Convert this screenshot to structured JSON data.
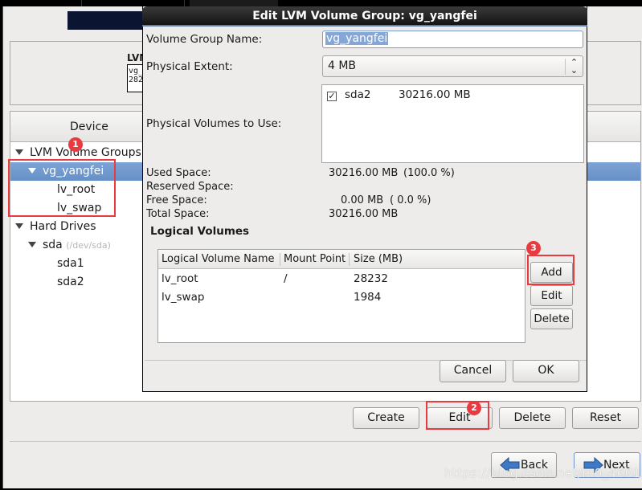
{
  "main_window": {
    "summary": {
      "title": "LVM",
      "mini_line1": "vg_",
      "mini_line2": "282"
    },
    "tree": {
      "column_header": "Device",
      "rows": [
        {
          "label": "LVM Volume Groups",
          "expandable": true,
          "level": 0
        },
        {
          "label": "vg_yangfei",
          "expandable": true,
          "level": 1,
          "selected": true
        },
        {
          "label": "lv_root",
          "level": 2
        },
        {
          "label": "lv_swap",
          "level": 2
        },
        {
          "label": "Hard Drives",
          "expandable": true,
          "level": 0
        },
        {
          "label": "sda",
          "sublabel": "(/dev/sda)",
          "expandable": true,
          "level": 1
        },
        {
          "label": "sda1",
          "level": 2
        },
        {
          "label": "sda2",
          "level": 2
        }
      ]
    },
    "actions": {
      "create": "Create",
      "edit": "Edit",
      "delete": "Delete",
      "reset": "Reset"
    },
    "nav": {
      "back": "Back",
      "next": "Next"
    }
  },
  "dialog": {
    "title": "Edit LVM Volume Group: vg_yangfei",
    "vg_name_label": "Volume Group Name:",
    "vg_name_value": "vg_yangfei",
    "pe_label": "Physical Extent:",
    "pe_value": "4 MB",
    "pv_label": "Physical Volumes to Use:",
    "physical_volumes": [
      {
        "checked": true,
        "name": "sda2",
        "size": "30216.00 MB"
      }
    ],
    "stats": {
      "used_label": "Used Space:",
      "used_value": "30216.00 MB",
      "used_pct": "(100.0 %)",
      "reserved_label": "Reserved Space:",
      "free_label": "Free Space:",
      "free_value": "0.00 MB",
      "free_pct": "( 0.0 %)",
      "total_label": "Total Space:",
      "total_value": "30216.00 MB"
    },
    "lv_section_title": "Logical Volumes",
    "lv_columns": [
      "Logical Volume Name",
      "Mount Point",
      "Size (MB)"
    ],
    "logical_volumes": [
      {
        "name": "lv_root",
        "mount": "/",
        "size": "28232"
      },
      {
        "name": "lv_swap",
        "mount": "",
        "size": "1984"
      }
    ],
    "lv_buttons": {
      "add": "Add",
      "edit": "Edit",
      "delete": "Delete"
    },
    "cancel": "Cancel",
    "ok": "OK"
  },
  "annotations": {
    "step1": "1",
    "step2": "2",
    "step3": "3",
    "color": "#e93a3f"
  },
  "watermark": "https://blog.csdn.net/m0_46015143"
}
